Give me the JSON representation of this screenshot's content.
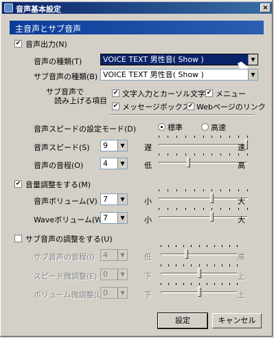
{
  "window": {
    "title": "音声基本設定",
    "close_label": "×"
  },
  "section": {
    "title": "主音声とサブ音声"
  },
  "voice_output": {
    "label": "音声出力(N)",
    "checked": true
  },
  "voice_type": {
    "label": "音声の種類(T)",
    "value": "VOICE TEXT 男性音( Show )"
  },
  "sub_voice_type": {
    "label": "サブ音声の種類(B)",
    "value": "VOICE TEXT 男性音( Show )"
  },
  "sub_read": {
    "label_line1": "サブ音声で",
    "label_line2": "読み上げる項目",
    "options": [
      {
        "label": "文字入力とカーソル文字",
        "checked": true
      },
      {
        "label": "メニュー",
        "checked": true
      },
      {
        "label": "メッセージボックス",
        "checked": true
      },
      {
        "label": "Webページのリンク",
        "checked": true
      }
    ]
  },
  "speed_mode": {
    "label": "音声スピードの設定モード(D)",
    "options": [
      "標準",
      "高速"
    ],
    "selected": "標準"
  },
  "speed": {
    "label": "音声スピード(S)",
    "value": "9",
    "low_label": "遅",
    "high_label": "速",
    "level": 1.0
  },
  "pitch": {
    "label": "音声の音程(O)",
    "value": "4",
    "low_label": "低",
    "high_label": "高",
    "level": 0.33
  },
  "volume_adjust": {
    "label": "音量調整をする(M)",
    "checked": true
  },
  "voice_volume": {
    "label": "音声ボリューム(V)",
    "value": "7",
    "low_label": "小",
    "high_label": "大",
    "level": 0.6
  },
  "wave_volume": {
    "label": "Waveボリューム(W)",
    "value": "7",
    "low_label": "小",
    "high_label": "大",
    "level": 0.6
  },
  "sub_adjust": {
    "label": "サブ音声の調整をする(U)",
    "checked": false
  },
  "sub_pitch": {
    "label": "サブ音声の音程(I)",
    "value": "4",
    "low_label": "低",
    "high_label": "高",
    "level": 0.33
  },
  "speed_fine": {
    "label": "スピード微調整(E)",
    "value": "0",
    "low_label": "下",
    "high_label": "上",
    "level": 0.5
  },
  "volume_fine": {
    "label": "ボリューム微調整(L)",
    "value": "0",
    "low_label": "下",
    "high_label": "上",
    "level": 0.5
  },
  "buttons": {
    "ok": "設定",
    "cancel": "キャンセル"
  },
  "icons": {
    "combo_arrow": "▼",
    "check": "✔"
  }
}
